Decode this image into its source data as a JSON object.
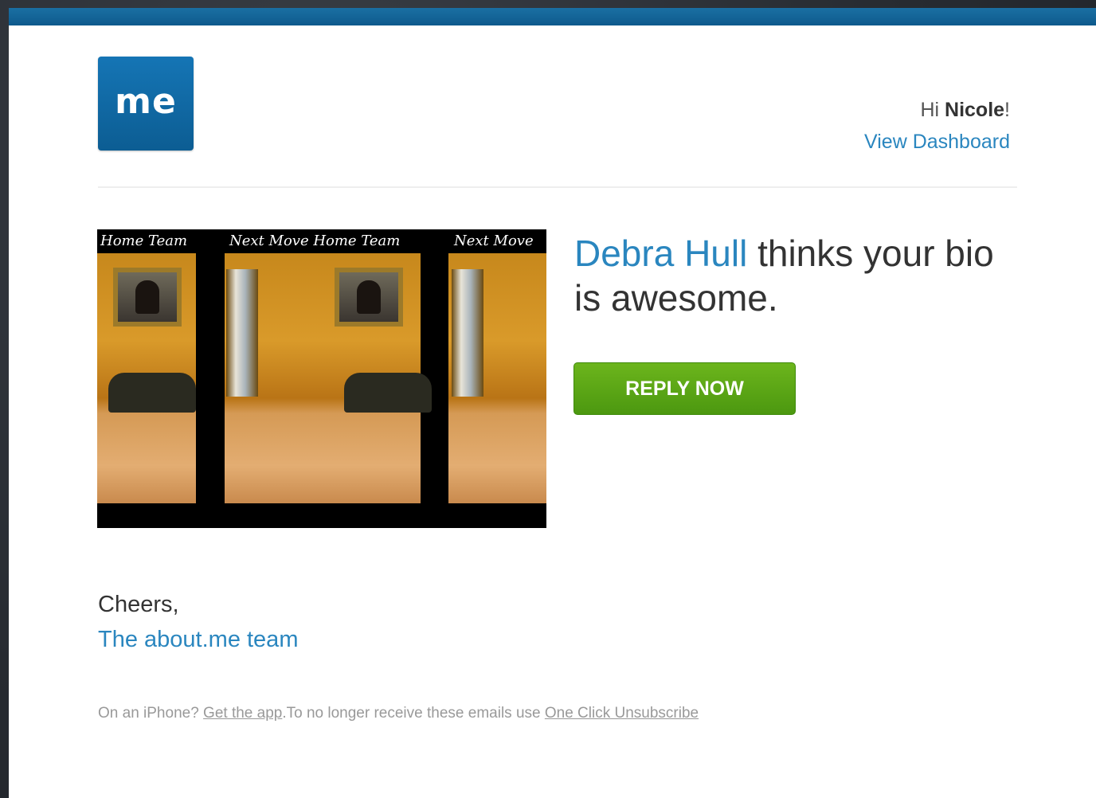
{
  "header": {
    "logo_text": "me",
    "greeting_prefix": "Hi ",
    "greeting_name": "Nicole",
    "greeting_suffix": "!",
    "dashboard_link": "View Dashboard"
  },
  "photo": {
    "labels": [
      "Home Team",
      "Next Move Home Team",
      "Next Move"
    ]
  },
  "message": {
    "sender": "Debra Hull",
    "text": " thinks your bio is awesome.",
    "reply_button": "REPLY NOW"
  },
  "signature": {
    "closing": "Cheers,",
    "team": "The about.me team"
  },
  "footer": {
    "iphone_prefix": "On an iPhone? ",
    "app_link": "Get the app",
    "unsub_text": ".To no longer receive these emails use ",
    "unsub_link": "One Click Unsubscribe"
  },
  "colors": {
    "brand_blue": "#0e5a8c",
    "link_blue": "#2a86bf",
    "button_green": "#5aa816"
  }
}
